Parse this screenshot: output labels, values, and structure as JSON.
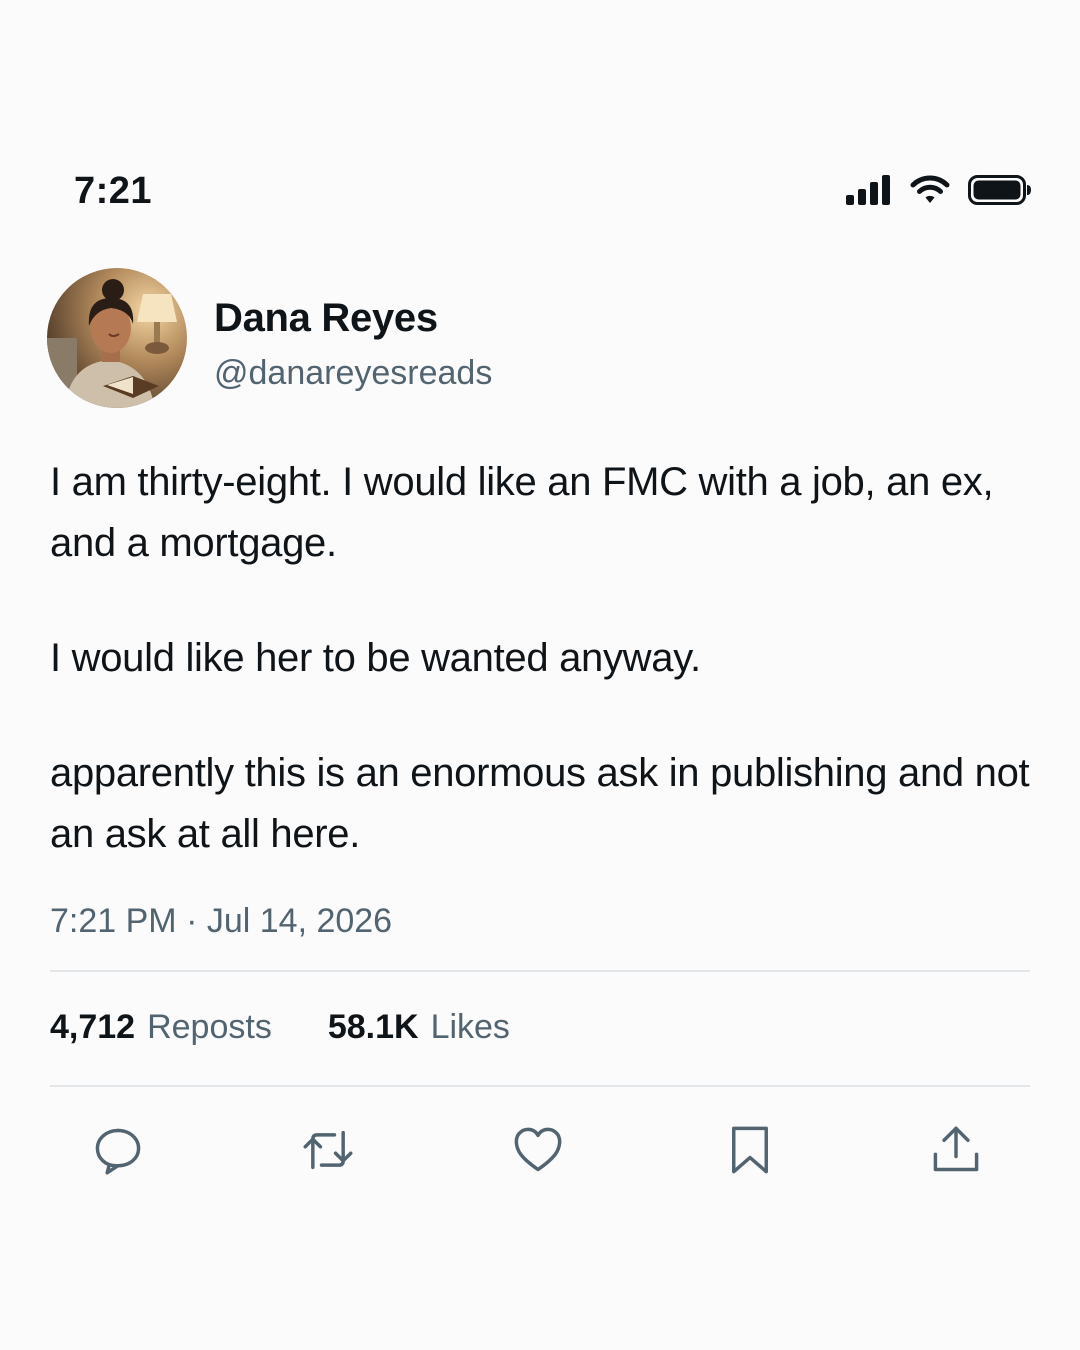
{
  "status_bar": {
    "time": "7:21",
    "icons": [
      "cellular-signal-icon",
      "wifi-icon",
      "battery-icon"
    ]
  },
  "post": {
    "author": {
      "display_name": "Dana Reyes",
      "handle": "@danareyesreads",
      "avatar_icon": "avatar-photo"
    },
    "paragraphs": [
      "I am thirty-eight. I would like an FMC with a job, an ex, and a mortgage.",
      "I would like her to be wanted anyway.",
      "apparently this is an enormous ask in publishing and not an ask at all here."
    ],
    "timestamp": "7:21 PM · Jul 14, 2026",
    "stats": {
      "reposts_count": "4,712",
      "reposts_label": "Reposts",
      "likes_count": "58.1K",
      "likes_label": "Likes"
    }
  },
  "actions": [
    "reply-icon",
    "repost-icon",
    "like-icon",
    "bookmark-icon",
    "share-icon"
  ],
  "colors": {
    "text": "#0f1419",
    "secondary": "#536471",
    "divider": "#e3e6e8",
    "background": "#fbfbfb"
  }
}
